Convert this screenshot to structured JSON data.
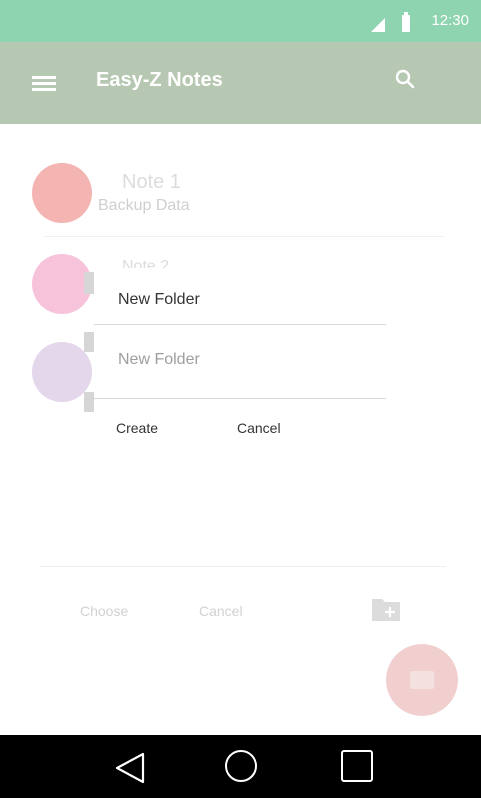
{
  "status_bar": {
    "time": "12:30",
    "signal_icon": "signal-icon",
    "battery_icon": "battery-icon"
  },
  "app_bar": {
    "title": "Easy-Z Notes",
    "menu_icon": "menu-icon",
    "search_icon": "search-icon"
  },
  "notes": [
    {
      "title": "Note 1",
      "subtitle": "Backup Data",
      "color": "#f2a7a3"
    },
    {
      "title": "Note 2",
      "color": "#f5b9d3"
    },
    {
      "color": "#dfcfe8"
    }
  ],
  "dialog": {
    "title_value": "New Folder",
    "input_placeholder": "New Folder",
    "create_label": "Create",
    "cancel_label": "Cancel"
  },
  "bottom_bar": {
    "choose_label": "Choose",
    "cancel_label": "Cancel",
    "add_folder_icon": "folder-add-icon"
  },
  "fab": {
    "icon": "folder-add-icon"
  },
  "colors": {
    "status_bar": "#8fd4b0",
    "app_bar": "#b7c8b2",
    "fab": "#f2cfcf"
  }
}
